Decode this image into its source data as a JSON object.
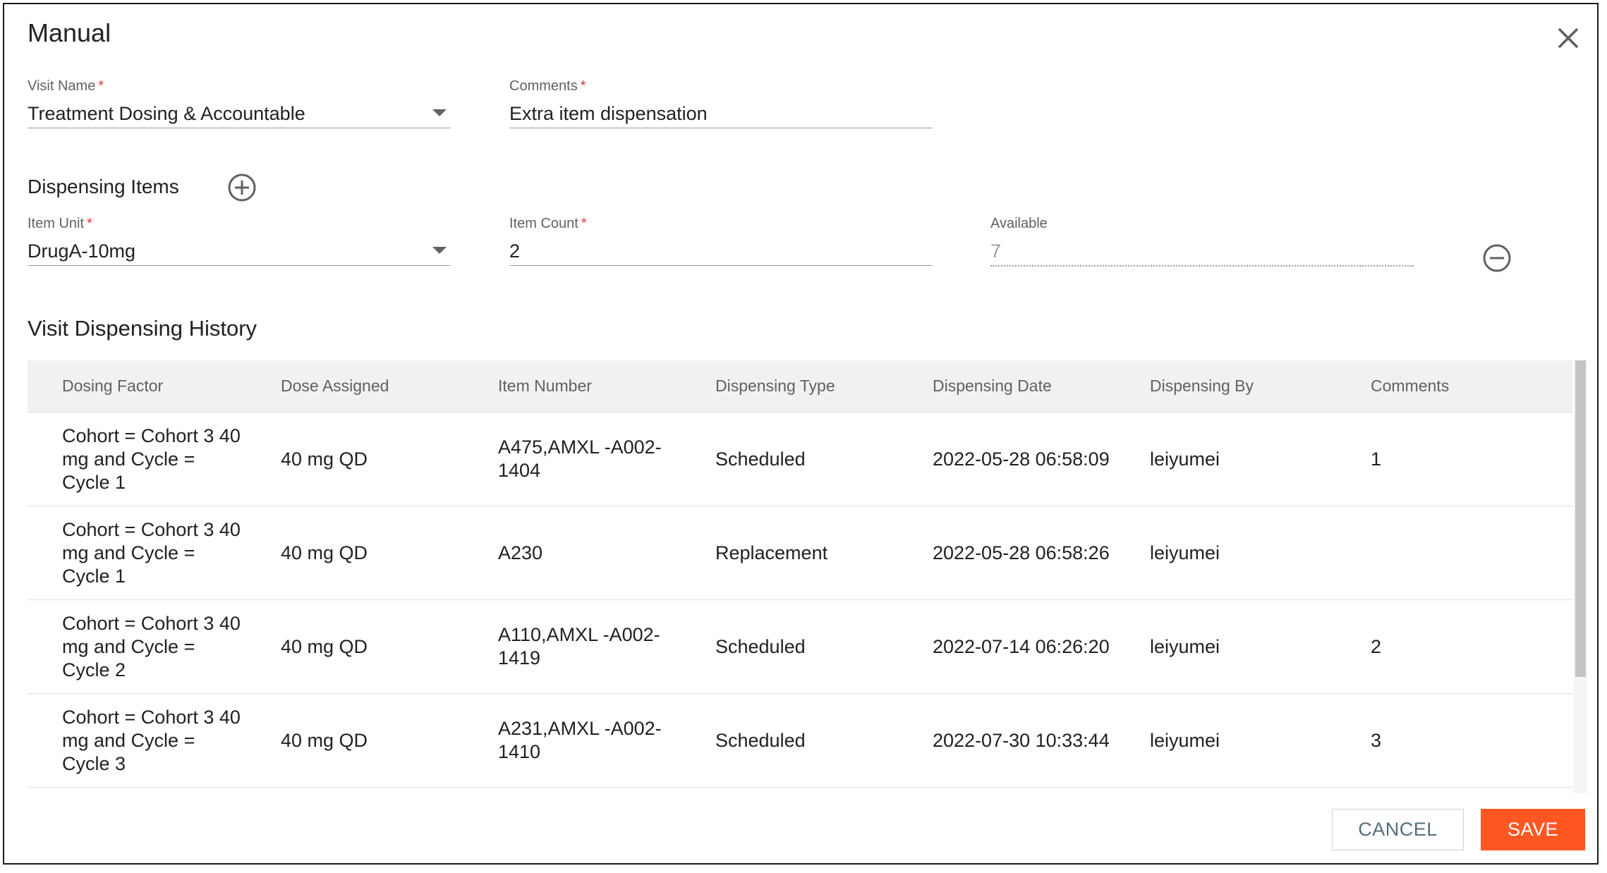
{
  "dialog": {
    "title": "Manual",
    "close_icon": "close-icon"
  },
  "form": {
    "visit_name": {
      "label": "Visit Name",
      "required_mark": "*",
      "value": "Treatment Dosing & Accountable"
    },
    "comments": {
      "label": "Comments",
      "required_mark": "*",
      "value": "Extra item dispensation"
    }
  },
  "dispensing_items": {
    "title": "Dispensing Items",
    "add_icon": "add-circle-icon",
    "item_unit": {
      "label": "Item Unit",
      "required_mark": "*",
      "value": "DrugA-10mg"
    },
    "item_count": {
      "label": "Item Count",
      "required_mark": "*",
      "value": "2"
    },
    "available": {
      "label": "Available",
      "value": "7"
    },
    "remove_icon": "remove-circle-icon"
  },
  "history": {
    "title": "Visit Dispensing History",
    "columns": [
      "Dosing Factor",
      "Dose Assigned",
      "Item Number",
      "Dispensing Type",
      "Dispensing Date",
      "Dispensing By",
      "Comments"
    ],
    "rows": [
      {
        "dosing_factor": [
          "Cohort = Cohort 3 40",
          "mg and Cycle =",
          "Cycle 1"
        ],
        "dose_assigned": "40 mg QD",
        "item_number": [
          "A475,AMXL -A002-",
          "1404"
        ],
        "dispensing_type": "Scheduled",
        "dispensing_date": "2022-05-28 06:58:09",
        "dispensing_by": "leiyumei",
        "comments": "1"
      },
      {
        "dosing_factor": [
          "Cohort = Cohort 3 40",
          "mg and Cycle =",
          "Cycle 1"
        ],
        "dose_assigned": "40 mg QD",
        "item_number": [
          "A230"
        ],
        "dispensing_type": "Replacement",
        "dispensing_date": "2022-05-28 06:58:26",
        "dispensing_by": "leiyumei",
        "comments": ""
      },
      {
        "dosing_factor": [
          "Cohort = Cohort 3 40",
          "mg and Cycle =",
          "Cycle 2"
        ],
        "dose_assigned": "40 mg QD",
        "item_number": [
          "A110,AMXL -A002-",
          "1419"
        ],
        "dispensing_type": "Scheduled",
        "dispensing_date": "2022-07-14 06:26:20",
        "dispensing_by": "leiyumei",
        "comments": "2"
      },
      {
        "dosing_factor": [
          "Cohort = Cohort 3 40",
          "mg and Cycle =",
          "Cycle 3"
        ],
        "dose_assigned": "40 mg QD",
        "item_number": [
          "A231,AMXL -A002-",
          "1410"
        ],
        "dispensing_type": "Scheduled",
        "dispensing_date": "2022-07-30 10:33:44",
        "dispensing_by": "leiyumei",
        "comments": "3"
      }
    ]
  },
  "footer": {
    "cancel_label": "CANCEL",
    "save_label": "SAVE"
  },
  "colors": {
    "accent": "#ff5722",
    "required": "#e53935",
    "header_bg": "#f1f1f1"
  }
}
